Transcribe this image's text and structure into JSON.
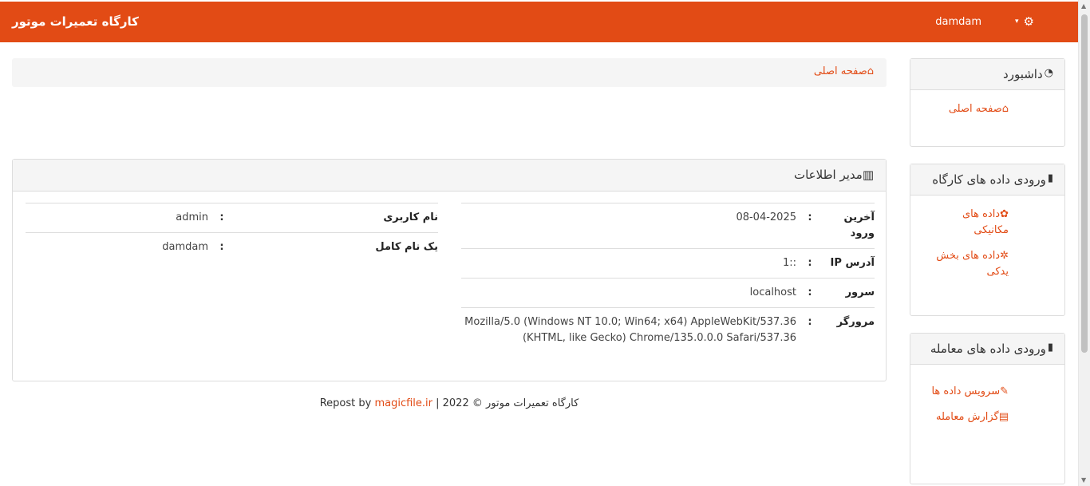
{
  "navbar": {
    "brand": "کارگاه تعمیرات موتور",
    "username": "damdam",
    "caret_icon": "▾",
    "gear_icon": "⚙"
  },
  "breadcrumb": {
    "home_icon": "⌂",
    "home_label": "صفحه اصلی"
  },
  "sidebar": {
    "dashboard": {
      "icon": "◔",
      "title": "داشبورد",
      "links": [
        {
          "icon": "⌂",
          "label": "صفحه اصلی"
        }
      ]
    },
    "workshop_input": {
      "icon": "▮",
      "title": "ورودی داده های کارگاه",
      "links": [
        {
          "icon": "✿",
          "label": "داده های مکانیکی"
        },
        {
          "icon": "✲",
          "label": "داده های بخش یدکی"
        }
      ]
    },
    "transaction_input": {
      "icon": "▮",
      "title": "ورودی داده های معامله",
      "links": [
        {
          "icon": "✎",
          "label": "سرویس داده ها"
        },
        {
          "icon": "▤",
          "label": "گزارش معامله"
        }
      ]
    }
  },
  "info_panel": {
    "icon": "▥",
    "title": "مدیر اطلاعات",
    "left_table": [
      {
        "label": "آخرین ورود",
        "value": "08-04-2025"
      },
      {
        "label": "آدرس IP",
        "value": "::1"
      },
      {
        "label": "سرور",
        "value": "localhost"
      },
      {
        "label": "مرورگر",
        "value": "Mozilla/5.0 (Windows NT 10.0; Win64; x64) AppleWebKit/537.36 (KHTML, like Gecko) Chrome/135.0.0.0 Safari/537.36"
      }
    ],
    "right_table": [
      {
        "label": "نام کاربری",
        "value": "admin"
      },
      {
        "label": "یک نام کامل",
        "value": "damdam"
      }
    ],
    "separator": ":"
  },
  "footer": {
    "repost_text": "Repost by",
    "link": "magicfile.ir",
    "rest": "| 2022 © کارگاه تعمیرات موتور"
  },
  "colors": {
    "accent": "#e24b15"
  }
}
